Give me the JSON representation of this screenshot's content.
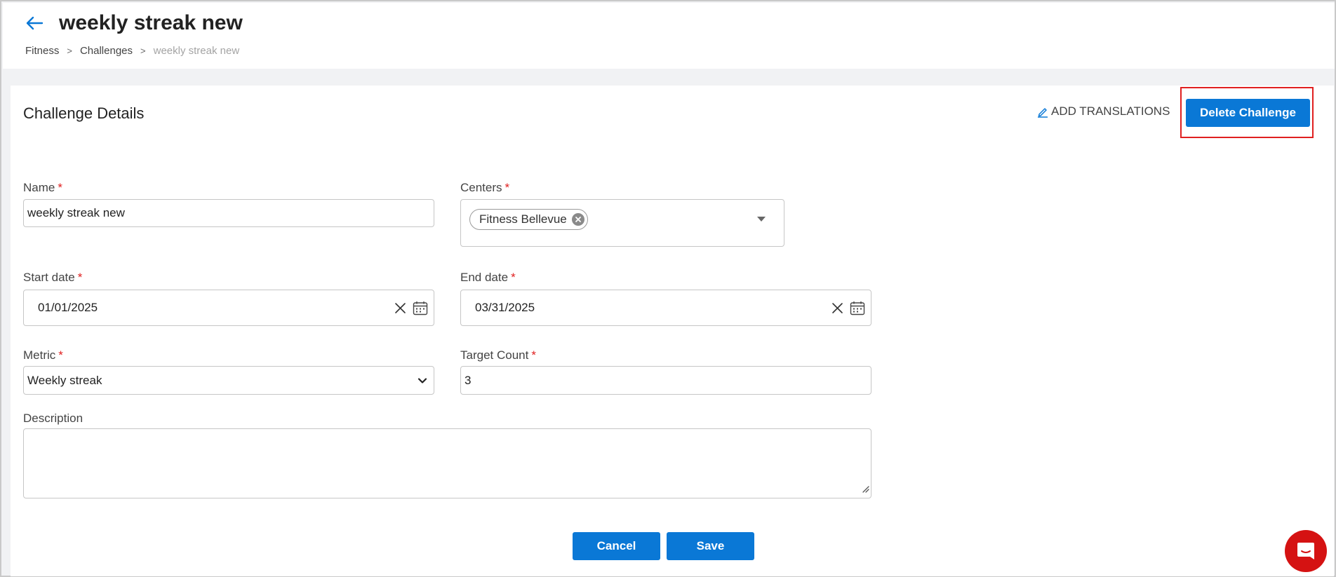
{
  "header": {
    "title": "weekly streak new",
    "breadcrumb": {
      "items": [
        "Fitness",
        "Challenges"
      ],
      "separator": ">",
      "current": "weekly streak new"
    }
  },
  "card": {
    "section_title": "Challenge Details",
    "add_translations_label": "ADD TRANSLATIONS",
    "delete_label": "Delete Challenge"
  },
  "form": {
    "name": {
      "label": "Name",
      "required": "*",
      "value": "weekly streak new"
    },
    "centers": {
      "label": "Centers",
      "required": "*",
      "selected": [
        "Fitness Bellevue"
      ]
    },
    "start_date": {
      "label": "Start date",
      "required": "*",
      "value": "01/01/2025"
    },
    "end_date": {
      "label": "End date",
      "required": "*",
      "value": "03/31/2025"
    },
    "metric": {
      "label": "Metric",
      "required": "*",
      "value": "Weekly streak"
    },
    "target_count": {
      "label": "Target Count",
      "required": "*",
      "value": "3"
    },
    "description": {
      "label": "Description",
      "value": ""
    }
  },
  "actions": {
    "cancel_label": "Cancel",
    "save_label": "Save"
  },
  "icons": {
    "back": "arrow-left-icon",
    "edit": "pencil-icon",
    "chip_remove": "close-circle-icon",
    "clear": "close-icon",
    "calendar": "calendar-icon",
    "select": "chevron-down-icon",
    "chat": "chat-bubble-icon"
  },
  "colors": {
    "primary": "#0a78d6",
    "required": "#e02020",
    "highlight": "#e02020",
    "chat_fab": "#d51212",
    "page_bg": "#f1f2f4"
  }
}
